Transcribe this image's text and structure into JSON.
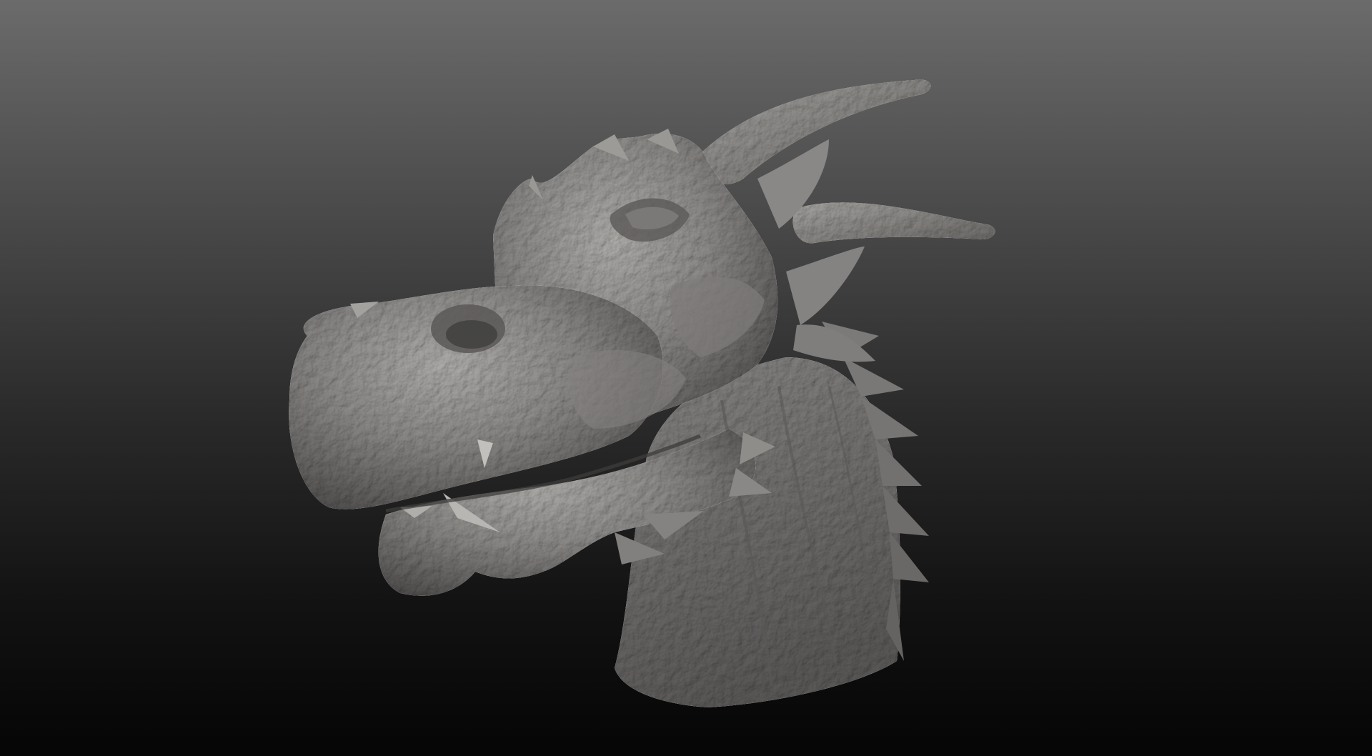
{
  "scene": {
    "subject": "dragon-head-sculpt",
    "background_top_color": "#6b6b6b",
    "background_bottom_color": "#050505",
    "clay_color": "#8f8d8b",
    "clay_highlight_color": "#b3b1ae",
    "clay_shadow_color": "#4e4c4b"
  }
}
